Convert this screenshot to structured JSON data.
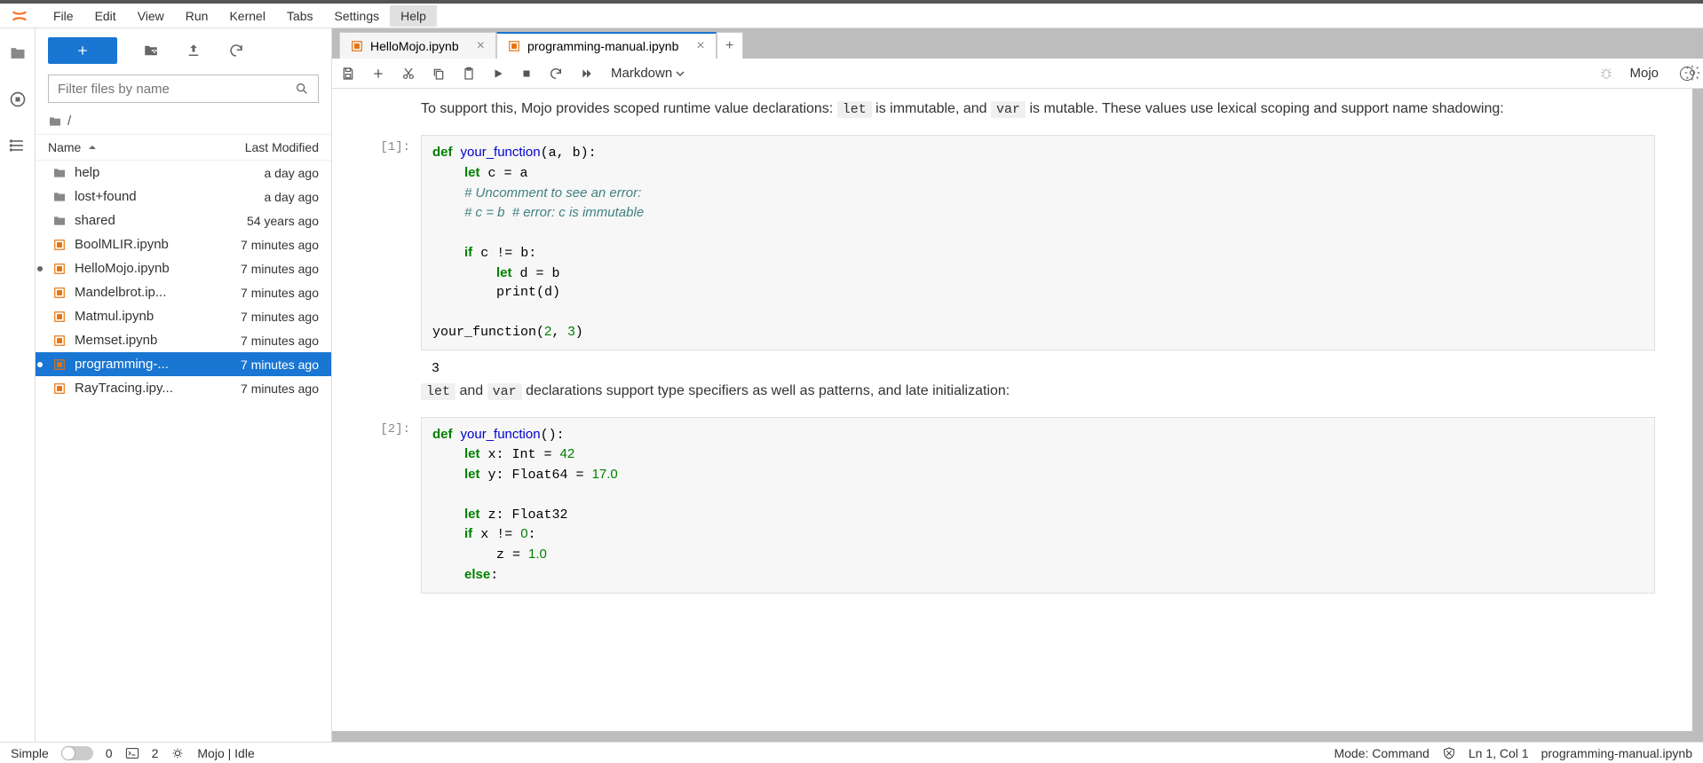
{
  "menu": {
    "items": [
      "File",
      "Edit",
      "View",
      "Run",
      "Kernel",
      "Tabs",
      "Settings",
      "Help"
    ],
    "active_index": 7
  },
  "file_toolbar": {
    "filter_placeholder": "Filter files by name"
  },
  "breadcrumb": {
    "path": "/"
  },
  "file_header": {
    "name": "Name",
    "modified": "Last Modified"
  },
  "files": [
    {
      "type": "dir",
      "name": "help",
      "modified": "a day ago",
      "running": false,
      "selected": false
    },
    {
      "type": "dir",
      "name": "lost+found",
      "modified": "a day ago",
      "running": false,
      "selected": false
    },
    {
      "type": "dir",
      "name": "shared",
      "modified": "54 years ago",
      "running": false,
      "selected": false
    },
    {
      "type": "nb",
      "name": "BoolMLIR.ipynb",
      "modified": "7 minutes ago",
      "running": false,
      "selected": false
    },
    {
      "type": "nb",
      "name": "HelloMojo.ipynb",
      "modified": "7 minutes ago",
      "running": true,
      "selected": false
    },
    {
      "type": "nb",
      "name": "Mandelbrot.ip...",
      "modified": "7 minutes ago",
      "running": false,
      "selected": false
    },
    {
      "type": "nb",
      "name": "Matmul.ipynb",
      "modified": "7 minutes ago",
      "running": false,
      "selected": false
    },
    {
      "type": "nb",
      "name": "Memset.ipynb",
      "modified": "7 minutes ago",
      "running": false,
      "selected": false
    },
    {
      "type": "nb",
      "name": "programming-...",
      "modified": "7 minutes ago",
      "running": true,
      "selected": true
    },
    {
      "type": "nb",
      "name": "RayTracing.ipy...",
      "modified": "7 minutes ago",
      "running": false,
      "selected": false
    }
  ],
  "tabs": [
    {
      "label": "HelloMojo.ipynb",
      "active": false,
      "closable": true
    },
    {
      "label": "programming-manual.ipynb",
      "active": true,
      "closable": true
    }
  ],
  "toolbar": {
    "cell_type": "Markdown",
    "kernel": "Mojo"
  },
  "notebook": {
    "md1_pre": "To support this, Mojo provides scoped runtime value declarations: ",
    "md1_code1": "let",
    "md1_mid1": " is immutable, and ",
    "md1_code2": "var",
    "md1_mid2": " is mutable. These values use lexical scoping and support name shadowing:",
    "cell1_prompt": "[1]:",
    "cell1_output": "3",
    "md2_code1": "let",
    "md2_mid1": " and ",
    "md2_code2": "var",
    "md2_post": " declarations support type specifiers as well as patterns, and late initialization:",
    "cell2_prompt": "[2]:"
  },
  "status": {
    "simple": "Simple",
    "terminals": "0",
    "terminals2": "2",
    "kernel": "Mojo | Idle",
    "mode": "Mode: Command",
    "cursor": "Ln 1, Col 1",
    "filename": "programming-manual.ipynb"
  }
}
